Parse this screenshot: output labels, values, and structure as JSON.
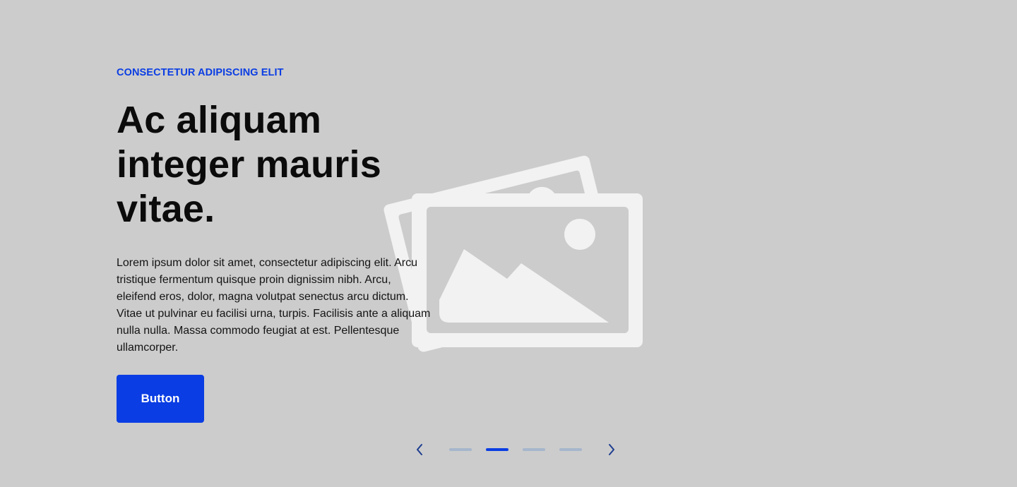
{
  "hero": {
    "eyebrow": "CONSECTETUR ADIPISCING ELIT",
    "headline": "Ac aliquam integer mauris vitae.",
    "body": "Lorem ipsum dolor sit amet, consectetur adipiscing elit. Arcu tristique fermentum quisque proin dignissim nibh. Arcu, eleifend eros, dolor, magna volutpat senectus arcu dictum. Vitae ut pulvinar eu facilisi urna, turpis. Facilisis ante a aliquam nulla nulla. Massa commodo feugiat at est. Pellentesque ullamcorper.",
    "button_label": "Button",
    "image_icon": "image-placeholder-icon"
  },
  "carousel": {
    "slide_count": 4,
    "active_index": 1,
    "prev_icon": "chevron-left-icon",
    "next_icon": "chevron-right-icon"
  },
  "colors": {
    "background": "#cccccc",
    "accent": "#0a3de3",
    "placeholder_graphic": "#f2f2f2",
    "inactive_dot": "#a6b6cc",
    "text": "#0b0b0b"
  }
}
